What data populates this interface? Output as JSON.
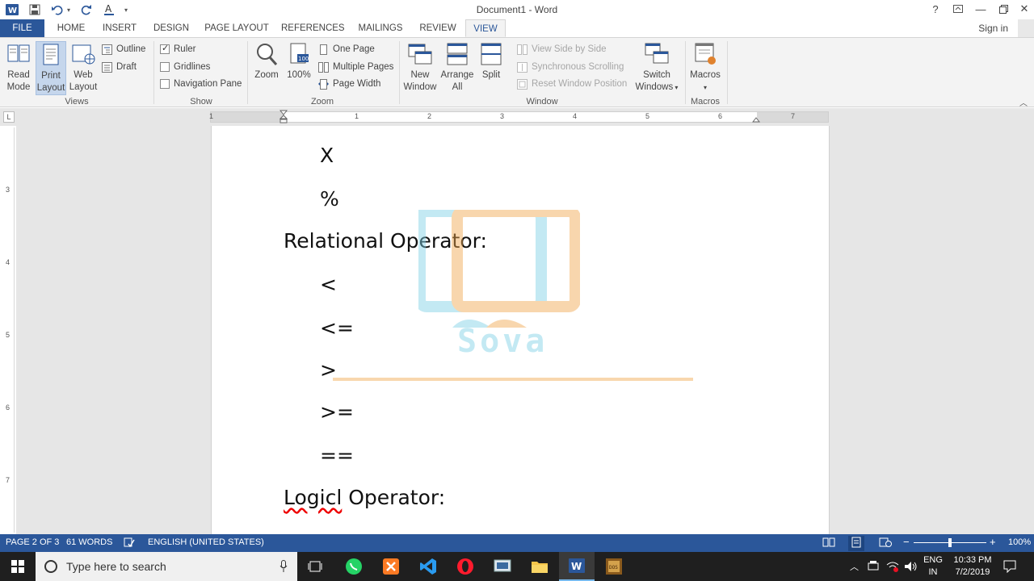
{
  "window": {
    "title": "Document1 - Word"
  },
  "tabs": [
    "FILE",
    "HOME",
    "INSERT",
    "DESIGN",
    "PAGE LAYOUT",
    "REFERENCES",
    "MAILINGS",
    "REVIEW",
    "VIEW"
  ],
  "account": {
    "signin": "Sign in"
  },
  "ribbon": {
    "views": {
      "label": "Views",
      "read_mode": [
        "Read",
        "Mode"
      ],
      "print_layout": [
        "Print",
        "Layout"
      ],
      "web_layout": [
        "Web",
        "Layout"
      ],
      "outline": "Outline",
      "draft": "Draft"
    },
    "show": {
      "label": "Show",
      "ruler": {
        "label": "Ruler",
        "checked": true
      },
      "gridlines": {
        "label": "Gridlines",
        "checked": false
      },
      "navigation_pane": {
        "label": "Navigation Pane",
        "checked": false
      }
    },
    "zoom": {
      "label": "Zoom",
      "zoom": "Zoom",
      "hundred": "100%",
      "one_page": "One Page",
      "multiple_pages": "Multiple Pages",
      "page_width": "Page Width"
    },
    "window": {
      "label": "Window",
      "new_window": [
        "New",
        "Window"
      ],
      "arrange_all": [
        "Arrange",
        "All"
      ],
      "split": "Split",
      "view_side_by_side": "View Side by Side",
      "synchronous_scrolling": "Synchronous Scrolling",
      "reset_window_position": "Reset Window Position",
      "switch_windows": [
        "Switch",
        "Windows"
      ]
    },
    "macros": {
      "label": "Macros",
      "macros": "Macros"
    }
  },
  "ruler": {
    "numbers": [
      "1",
      "1",
      "2",
      "3",
      "4",
      "5",
      "6",
      "7"
    ],
    "vertical_numbers": [
      "3",
      "4",
      "5",
      "6",
      "7"
    ]
  },
  "document": {
    "lines": [
      {
        "text": "X",
        "indent": true
      },
      {
        "text": "%",
        "indent": true
      },
      {
        "text": "Relational Operator:",
        "indent": false
      },
      {
        "text": "<",
        "indent": true
      },
      {
        "text": "<=",
        "indent": true
      },
      {
        "text": ">",
        "indent": true
      },
      {
        "text": ">=",
        "indent": true
      },
      {
        "text": "==",
        "indent": true
      },
      {
        "text": "Logicl Operator:",
        "indent": false
      }
    ],
    "watermark": "Sova"
  },
  "statusbar": {
    "page": "PAGE 2 OF 3",
    "words": "61 WORDS",
    "language": "ENGLISH (UNITED STATES)",
    "zoom": "100%",
    "zoom_level": 0.5
  },
  "taskbar": {
    "search_placeholder": "Type here to search",
    "lang_top": "ENG",
    "lang_bottom": "IN",
    "time": "10:33 PM",
    "date": "7/2/2019"
  },
  "colors": {
    "accent": "#2b579a",
    "taskbar": "#1f1f1f"
  }
}
